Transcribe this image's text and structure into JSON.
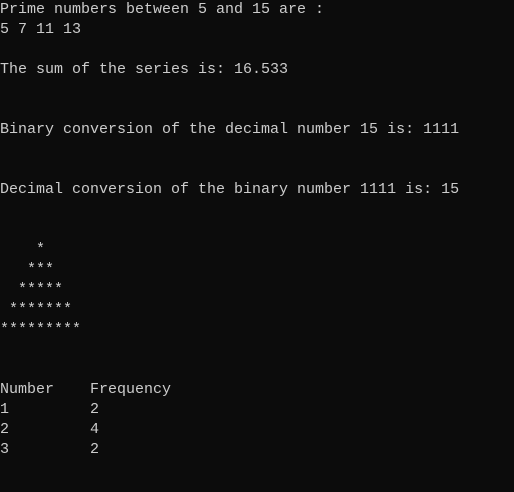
{
  "console": {
    "background": "#0c0c0c",
    "foreground": "#cccccc",
    "primes_heading": "Prime numbers between 5 and 15 are :",
    "primes_list": "5 7 11 13",
    "series_sum": "The sum of the series is: 16.533",
    "binary_conversion": "Binary conversion of the decimal number 15 is: 1111",
    "decimal_conversion": "Decimal conversion of the binary number 1111 is: 15",
    "pyramid": [
      "    *",
      "   ***",
      "  *****",
      " *******",
      "*********"
    ],
    "frequency_table": {
      "headers": [
        "Number",
        "Frequency"
      ],
      "rows": [
        [
          "1",
          "2"
        ],
        [
          "2",
          "4"
        ],
        [
          "3",
          "2"
        ]
      ]
    }
  }
}
